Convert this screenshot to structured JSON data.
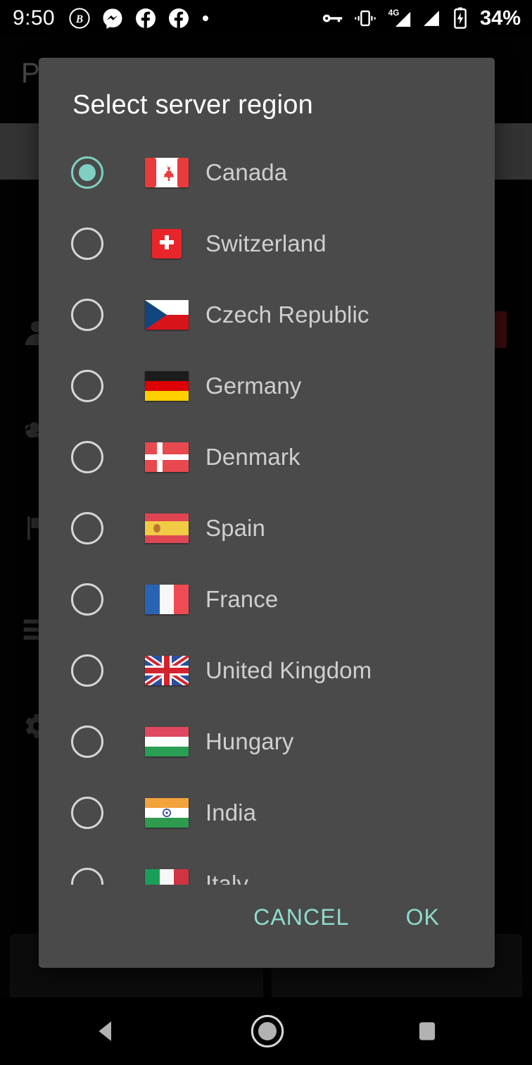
{
  "statusbar": {
    "clock": "9:50",
    "battery_percent": "34%",
    "network_type": "4G",
    "left_icons": [
      "bitcoin-app-icon",
      "messenger-icon",
      "facebook-icon",
      "facebook-icon",
      "dot-icon"
    ],
    "right_icons": [
      "vpn-key-icon",
      "vibrate-icon",
      "signal-4g-icon",
      "signal-icon",
      "battery-charging-icon"
    ]
  },
  "background": {
    "app_title": "P",
    "rows": [
      "person-icon",
      "key-icon",
      "flag-icon",
      "list-icon",
      "gear-icon"
    ]
  },
  "dialog": {
    "title": "Select server region",
    "selected_index": 0,
    "accent_color": "#7fd0c2",
    "surface_color": "#4a4a4a",
    "options": [
      {
        "label": "Canada",
        "flag": "flag-ca",
        "selected": true
      },
      {
        "label": "Switzerland",
        "flag": "flag-ch",
        "selected": false
      },
      {
        "label": "Czech Republic",
        "flag": "flag-cz",
        "selected": false
      },
      {
        "label": "Germany",
        "flag": "flag-de",
        "selected": false
      },
      {
        "label": "Denmark",
        "flag": "flag-dk",
        "selected": false
      },
      {
        "label": "Spain",
        "flag": "flag-es",
        "selected": false
      },
      {
        "label": "France",
        "flag": "flag-fr",
        "selected": false
      },
      {
        "label": "United Kingdom",
        "flag": "flag-gb",
        "selected": false
      },
      {
        "label": "Hungary",
        "flag": "flag-hu",
        "selected": false
      },
      {
        "label": "India",
        "flag": "flag-in",
        "selected": false
      },
      {
        "label": "Italy",
        "flag": "flag-it",
        "selected": false
      }
    ],
    "cancel_label": "CANCEL",
    "ok_label": "OK"
  },
  "navbar": {
    "back": "back-icon",
    "home": "home-icon",
    "recents": "recents-icon"
  }
}
